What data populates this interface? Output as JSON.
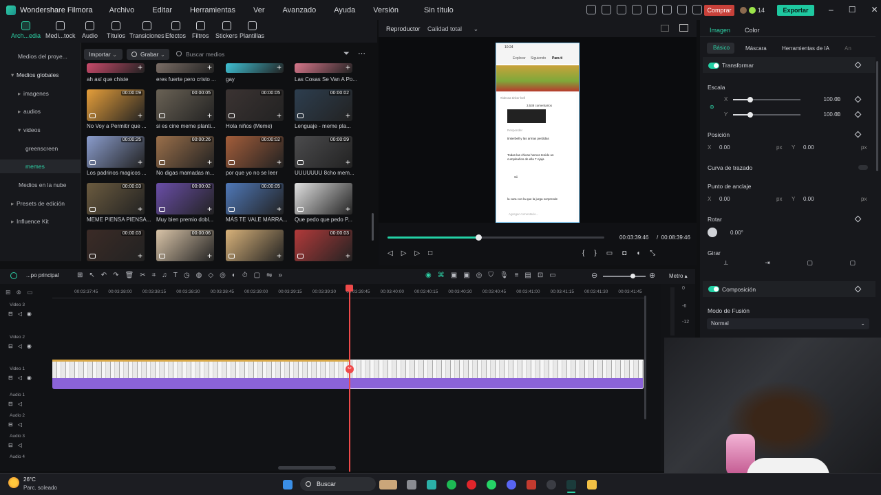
{
  "app": {
    "name": "Wondershare Filmora",
    "doc_title": "Sin título",
    "buy_label": "Comprar",
    "credits": "14",
    "export_label": "Exportar"
  },
  "menu": [
    "Archivo",
    "Editar",
    "Herramientas",
    "Ver",
    "Avanzado",
    "Ayuda",
    "Versión"
  ],
  "toolbar": [
    "Arch...edia",
    "Medi...tock",
    "Audio",
    "Títulos",
    "Transiciones",
    "Efectos",
    "Filtros",
    "Stickers",
    "Plantillas"
  ],
  "sidebar": {
    "items": [
      {
        "label": "Medios del proye...",
        "arrow": ""
      },
      {
        "label": "Medios globales",
        "arrow": "▾"
      },
      {
        "label": "imagenes",
        "arrow": "▸"
      },
      {
        "label": "audios",
        "arrow": "▸"
      },
      {
        "label": "videos",
        "arrow": "▾"
      },
      {
        "label": "greenscreen",
        "arrow": ""
      },
      {
        "label": "memes",
        "arrow": ""
      },
      {
        "label": "Medios en la nube",
        "arrow": ""
      },
      {
        "label": "Presets de edición",
        "arrow": "▸"
      },
      {
        "label": "Influence Kit",
        "arrow": "▸"
      }
    ]
  },
  "media": {
    "import_label": "Importar",
    "record_label": "Grabar",
    "search_placeholder": "Buscar medios",
    "items": [
      {
        "label": "ah así que chiste",
        "dur": "",
        "color": "#c94a6a"
      },
      {
        "label": "eres fuerte pero cristo ...",
        "dur": "",
        "color": "#7a6d65"
      },
      {
        "label": "gay",
        "dur": "",
        "color": "#3fc1d4"
      },
      {
        "label": "Las Cosas Se Van A Po...",
        "dur": "",
        "color": "#d6768a"
      },
      {
        "label": "No Voy a Permitir que ...",
        "dur": "00:00:09",
        "color": "#e59e3a"
      },
      {
        "label": "si es cine meme planti...",
        "dur": "00:00:05",
        "color": "#6a6255"
      },
      {
        "label": "Hola niños (Meme)",
        "dur": "00:00:05",
        "color": "#3b3332"
      },
      {
        "label": "Lenguaje - meme pla...",
        "dur": "00:00:02",
        "color": "#2d3e4f"
      },
      {
        "label": "Los padrinos magicos ...",
        "dur": "00:00:25",
        "color": "#8a9ccc"
      },
      {
        "label": "No digas mamadas m...",
        "dur": "00:00:26",
        "color": "#9a6f4a"
      },
      {
        "label": "por que yo no se leer",
        "dur": "00:00:02",
        "color": "#a35d3a"
      },
      {
        "label": "UUUUUUU 8cho mem...",
        "dur": "00:00:09",
        "color": "#4b4b4d"
      },
      {
        "label": "MEME PIENSA PIENSA...",
        "dur": "00:00:03",
        "color": "#6b5b3f"
      },
      {
        "label": "Muy bien premio dobl...",
        "dur": "00:00:02",
        "color": "#6a4ea8"
      },
      {
        "label": "MÁS TE VALE MARRA...",
        "dur": "00:00:05",
        "color": "#4f78b8"
      },
      {
        "label": "Que pedo que pedo  P...",
        "dur": "",
        "color": "#e0e0e0"
      },
      {
        "label": "",
        "dur": "00:00:03",
        "color": "#3b2b26"
      },
      {
        "label": "",
        "dur": "00:00:06",
        "color": "#d9c4a8"
      },
      {
        "label": "",
        "dur": "",
        "color": "#d8b27a"
      },
      {
        "label": "",
        "dur": "00:00:03",
        "color": "#b23a3a"
      }
    ]
  },
  "player": {
    "label": "Reproductor",
    "quality": "Calidad total",
    "current_time": "00:03:39:46",
    "total_time": "00:08:39:46",
    "progress": 0.42,
    "phone": {
      "time": "10:24",
      "tabs": [
        "Explorar",
        "Siguiendo",
        "Para ti"
      ],
      "search": "#idessa tinker bell",
      "comments_count": "3,538 comentarios",
      "comments": [
        "tinkerbell y las armas perdidas",
        "Todas las chicas hemos tenido un cumpleaños de ella 7 Ajaja",
        "Sii",
        "la cara con la que la jurga sorprende"
      ],
      "reply": "Responder",
      "add_comment": "Agregar comentario..."
    }
  },
  "props": {
    "tabs": [
      "Imagen",
      "Color"
    ],
    "subtabs": [
      "Básico",
      "Máscara",
      "Herramientas de IA",
      "An"
    ],
    "transform": "Transformar",
    "scale": "Escala",
    "x": "X",
    "y": "Y",
    "scale_x": "100.00",
    "scale_y": "100.00",
    "pct": "%",
    "position": "Posición",
    "pos_x": "0.00",
    "pos_y": "0.00",
    "px": "px",
    "path_curve": "Curva de trazado",
    "anchor": "Punto de anclaje",
    "anchor_x": "0.00",
    "anchor_y": "0.00",
    "rotate": "Rotar",
    "rotate_val": "0.00°",
    "flip": "Girar",
    "composition": "Composición",
    "blend_mode": "Modo de Fusión",
    "blend_val": "Normal"
  },
  "timeline": {
    "track_label": "...po principal",
    "meter_label": "Metro",
    "ruler": [
      "00:03:37:45",
      "00:03:38:00",
      "00:03:38:15",
      "00:03:38:30",
      "00:03:38:45",
      "00:03:39:00",
      "00:03:39:15",
      "00:03:39:30",
      "00:03:39:45",
      "00:03:40:00",
      "00:03:40:15",
      "00:03:40:30",
      "00:03:40:45",
      "00:03:41:00",
      "00:03:41:15",
      "00:03:41:30",
      "00:03:41:45"
    ],
    "tracks": [
      "Video 3",
      "Video 2",
      "Video 1",
      "Audio 1",
      "Audio 2",
      "Audio 3",
      "Audio 4"
    ],
    "meter_ticks": [
      "0",
      "-6",
      "-12"
    ]
  },
  "taskbar": {
    "temp": "26°C",
    "weather": "Parc. soleado",
    "search": "Buscar"
  }
}
